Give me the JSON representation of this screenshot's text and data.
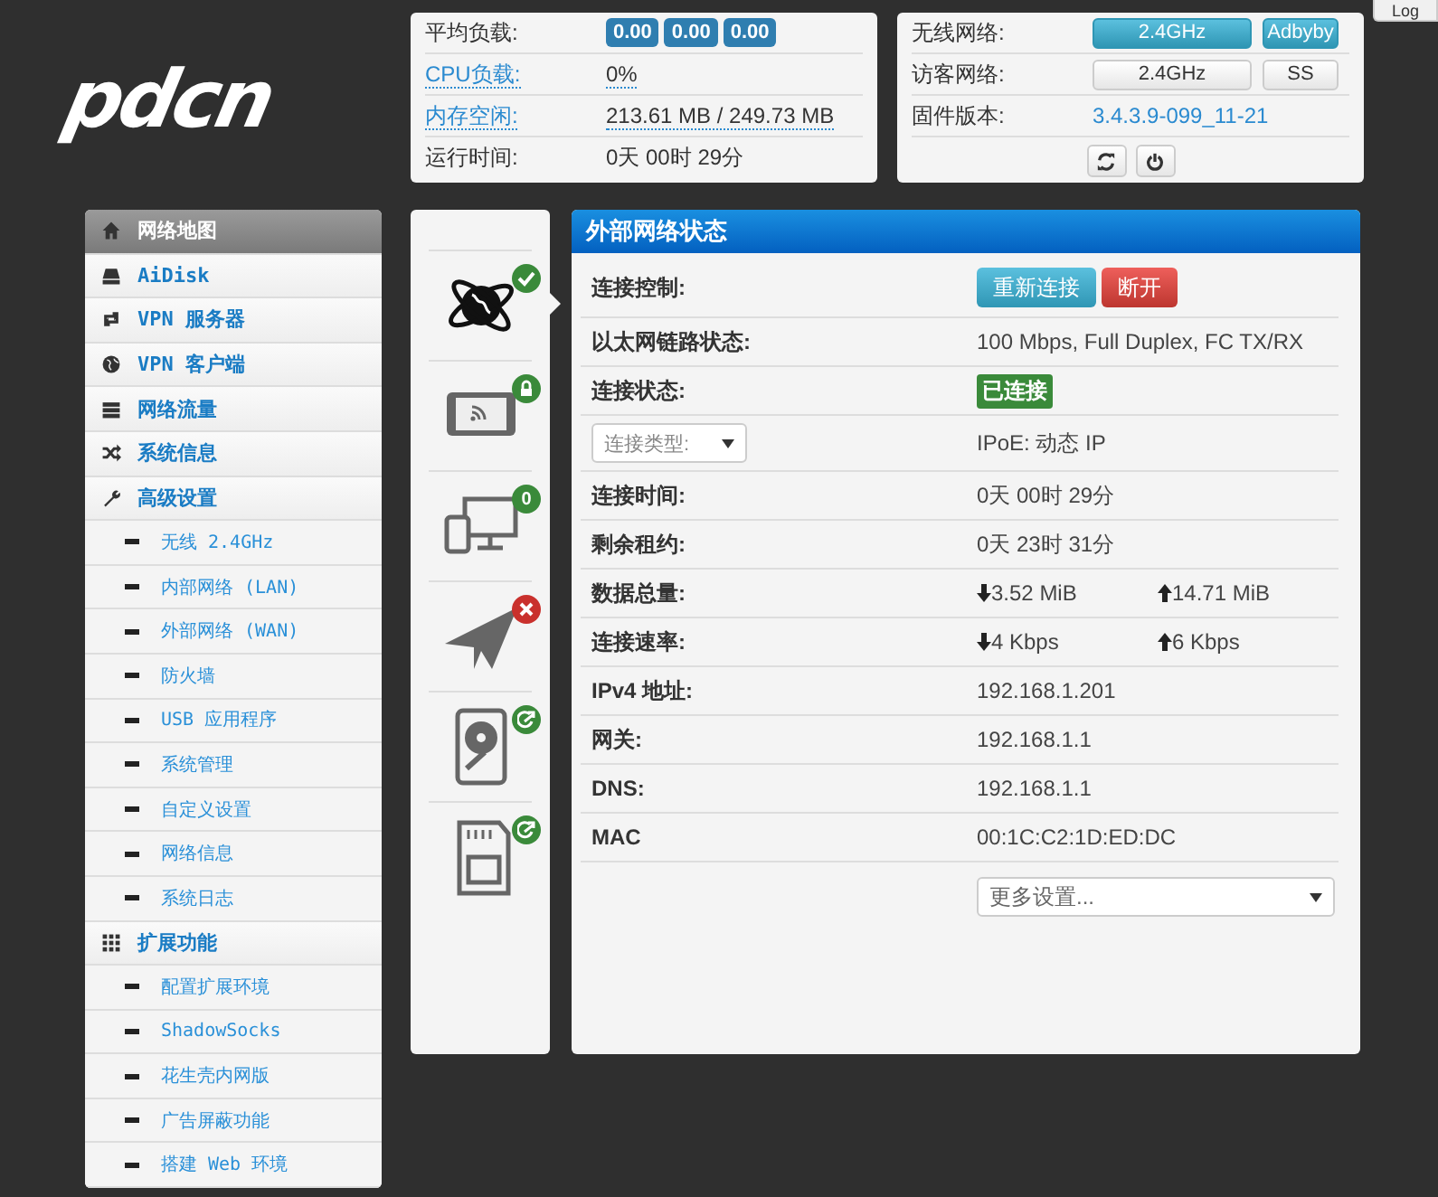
{
  "top_button": {
    "label": "Log"
  },
  "logo": {
    "text": "pdcn"
  },
  "status": {
    "rows": [
      {
        "label": "平均负载:",
        "linked": false,
        "kind": "badges",
        "values": [
          "0.00",
          "0.00",
          "0.00"
        ]
      },
      {
        "label": "CPU负载:",
        "linked": true,
        "kind": "text",
        "value": "0%"
      },
      {
        "label": "内存空闲:",
        "linked": true,
        "kind": "text",
        "value": "213.61 MB / 249.73 MB"
      },
      {
        "label": "运行时间:",
        "linked": false,
        "kind": "plain",
        "value": "0天 00时 29分"
      }
    ]
  },
  "radio": {
    "rows": [
      {
        "label": "无线网络:",
        "kind": "toggles",
        "buttons": [
          {
            "label": "2.4GHz",
            "on": true
          },
          {
            "label": "Adbyby",
            "on": true
          }
        ]
      },
      {
        "label": "访客网络:",
        "kind": "toggles",
        "buttons": [
          {
            "label": "2.4GHz",
            "on": false
          },
          {
            "label": "SS",
            "on": false
          }
        ]
      },
      {
        "label": "固件版本:",
        "kind": "link",
        "value": "3.4.3.9-099_11-21"
      }
    ]
  },
  "sidebar": {
    "items": [
      {
        "label": "网络地图",
        "selected": true
      },
      {
        "label": "AiDisk",
        "selected": false
      },
      {
        "label": "VPN 服务器",
        "selected": false
      },
      {
        "label": "VPN 客户端",
        "selected": false
      },
      {
        "label": "网络流量",
        "selected": false
      },
      {
        "label": "系统信息",
        "selected": false
      },
      {
        "label": "高级设置",
        "selected": false,
        "children": [
          {
            "label": "无线 2.4GHz",
            "selected": false
          },
          {
            "label": "内部网络 (LAN)",
            "selected": false
          },
          {
            "label": "外部网络 (WAN)",
            "selected": false
          },
          {
            "label": "防火墙",
            "selected": false
          },
          {
            "label": "USB 应用程序",
            "selected": false
          },
          {
            "label": "系统管理",
            "selected": false
          },
          {
            "label": "自定义设置",
            "selected": false
          },
          {
            "label": "网络信息",
            "selected": false
          },
          {
            "label": "系统日志",
            "selected": false
          }
        ]
      },
      {
        "label": "扩展功能",
        "selected": false,
        "children": [
          {
            "label": "配置扩展环境",
            "selected": false
          },
          {
            "label": "ShadowSocks",
            "selected": false
          },
          {
            "label": "花生壳内网版",
            "selected": false
          },
          {
            "label": "广告屏蔽功能",
            "selected": false
          },
          {
            "label": "搭建 Web 环境",
            "selected": false
          }
        ]
      }
    ]
  },
  "devices": [
    {
      "selected": true,
      "kind": "ok"
    },
    {
      "selected": false,
      "kind": "locked"
    },
    {
      "selected": false,
      "kind": "count",
      "count": "0"
    },
    {
      "selected": false,
      "kind": "error"
    },
    {
      "selected": false,
      "kind": "eject"
    },
    {
      "selected": false,
      "kind": "eject"
    }
  ],
  "panel": {
    "title": "外部网络状态",
    "rows": [
      {
        "kind": "buttons",
        "label": "连接控制:",
        "buttons": [
          {
            "label": "重新连接"
          },
          {
            "label": "断开"
          }
        ]
      },
      {
        "kind": "text",
        "label": "以太网链路状态:",
        "value": "100 Mbps, Full Duplex, FC TX/RX"
      },
      {
        "kind": "badge",
        "label": "连接状态:",
        "value": "已连接"
      },
      {
        "kind": "select",
        "label": "连接类型:",
        "value": "IPoE: 动态 IP"
      },
      {
        "kind": "text",
        "label": "连接时间:",
        "value": "0天 00时 29分"
      },
      {
        "kind": "text",
        "label": "剩余租约:",
        "value": "0天 23时 31分"
      },
      {
        "kind": "traffic",
        "label": "数据总量:",
        "down": "3.52 MiB",
        "up": "14.71 MiB"
      },
      {
        "kind": "traffic",
        "label": "连接速率:",
        "down": "4 Kbps",
        "up": "6 Kbps"
      },
      {
        "kind": "text",
        "label": "IPv4 地址:",
        "value": "192.168.1.201"
      },
      {
        "kind": "text",
        "label": "网关:",
        "value": "192.168.1.1"
      },
      {
        "kind": "text",
        "label": "DNS:",
        "value": "192.168.1.1"
      },
      {
        "kind": "text",
        "label": "MAC",
        "value": "00:1C:C2:1D:ED:DC"
      },
      {
        "kind": "more",
        "value": "更多设置..."
      }
    ]
  }
}
